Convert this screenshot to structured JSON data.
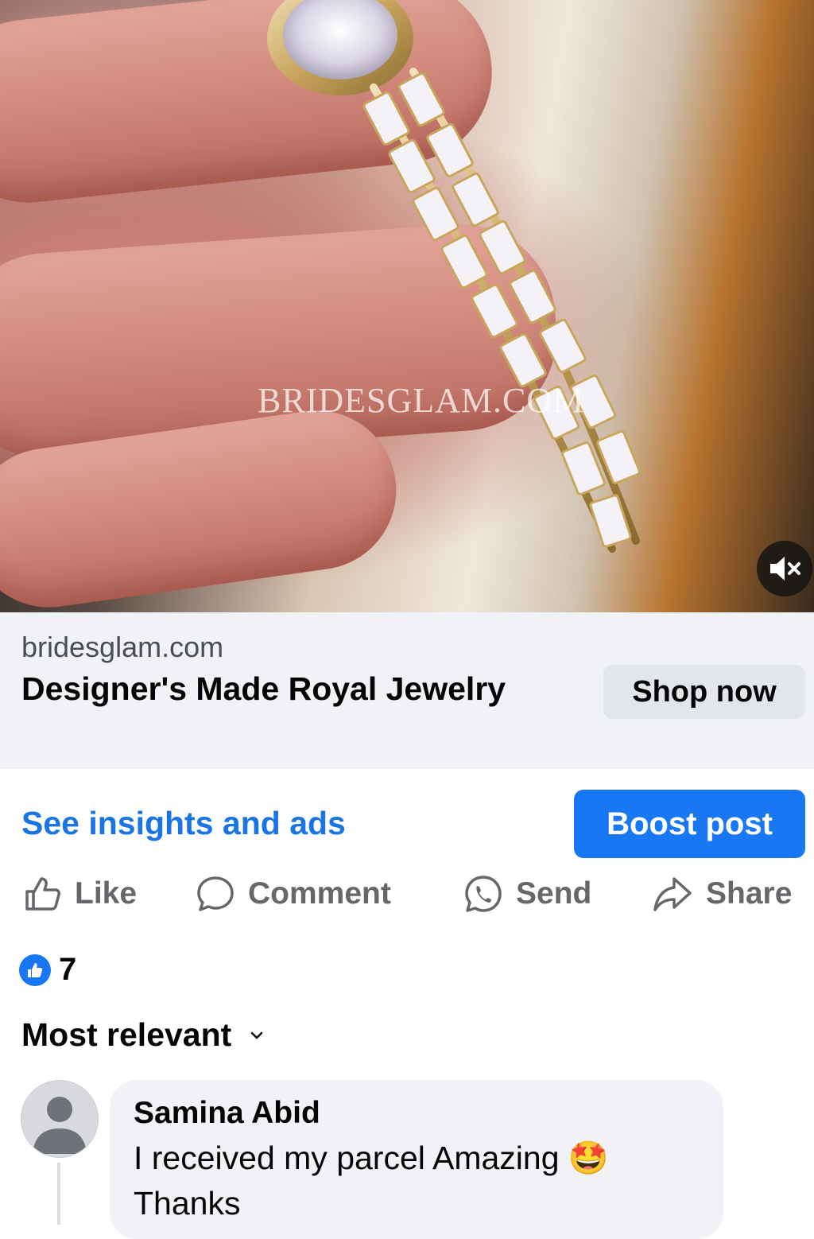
{
  "media": {
    "watermark": "BRIDESGLAM.COM",
    "mute_icon": "speaker-muted-icon"
  },
  "link_card": {
    "domain": "bridesglam.com",
    "headline": "Designer's Made Royal Jewelry",
    "cta_label": "Shop now"
  },
  "owner_tools": {
    "insights_label": "See insights and ads",
    "boost_label": "Boost post",
    "boost_color": "#1877f2",
    "link_color": "#1b74e4"
  },
  "actions": [
    {
      "label": "Like",
      "icon": "thumbs-up-icon"
    },
    {
      "label": "Comment",
      "icon": "comment-bubble-icon"
    },
    {
      "label": "Send",
      "icon": "whatsapp-icon"
    },
    {
      "label": "Share",
      "icon": "share-arrow-icon"
    }
  ],
  "reactions": {
    "icon": "like-reaction-icon",
    "count": "7"
  },
  "comments_sort": {
    "label": "Most relevant",
    "icon": "chevron-down-icon"
  },
  "comments": [
    {
      "author": "Samina Abid",
      "text": "I received my parcel Amazing",
      "emoji": "🤩",
      "text_line2": "Thanks"
    }
  ]
}
